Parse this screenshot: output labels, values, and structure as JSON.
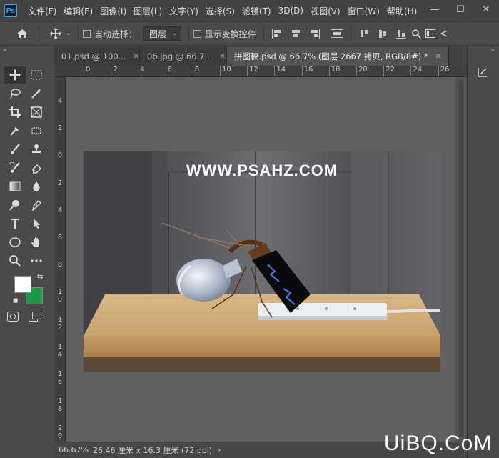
{
  "app": {
    "logo_text": "Ps"
  },
  "menu": [
    "文件(F)",
    "编辑(E)",
    "图像(I)",
    "图层(L)",
    "文字(Y)",
    "选择(S)",
    "滤镜(T)",
    "3D(D)",
    "视图(V)",
    "窗口(W)",
    "帮助(H)"
  ],
  "window_controls": {
    "minimize": "—",
    "maximize": "☐",
    "close": "✕"
  },
  "options_bar": {
    "home_icon": "home-icon",
    "move_icon": "move-icon",
    "auto_select_label": "自动选择：",
    "auto_select_checked": false,
    "layer_select_value": "图层",
    "show_transform_label": "显示变换控件",
    "show_transform_checked": false
  },
  "panel_collapse": {
    "left": "«",
    "right": "»"
  },
  "tabs": [
    {
      "label": "01.psd @ 100...",
      "close": "✕",
      "active": false
    },
    {
      "label": "06.jpg @ 66.7...",
      "close": "✕",
      "active": false
    },
    {
      "label": "拼图稿.psd @ 66.7% (图层 2667 拷贝, RGB/8#) *",
      "close": "✕",
      "active": true
    }
  ],
  "hruler_labels": [
    "0",
    "2",
    "4",
    "6",
    "8",
    "10",
    "12",
    "14",
    "16",
    "18",
    "20",
    "22",
    "24",
    "26"
  ],
  "vruler_labels": [
    "4",
    "2",
    "0",
    "2",
    "4",
    "6",
    "8",
    "10",
    "12",
    "14",
    "16",
    "18",
    "20"
  ],
  "canvas": {
    "watermark": "WWW.PSAHZ.COM"
  },
  "colors": {
    "foreground": "#ffffff",
    "background": "#1a9a4a"
  },
  "status": {
    "zoom": "66.67%",
    "doc_info": "26.46 厘米 x 16.3 厘米 (72 ppi)",
    "arrow": "›"
  },
  "overlay_brand": "UiBQ.CoM"
}
